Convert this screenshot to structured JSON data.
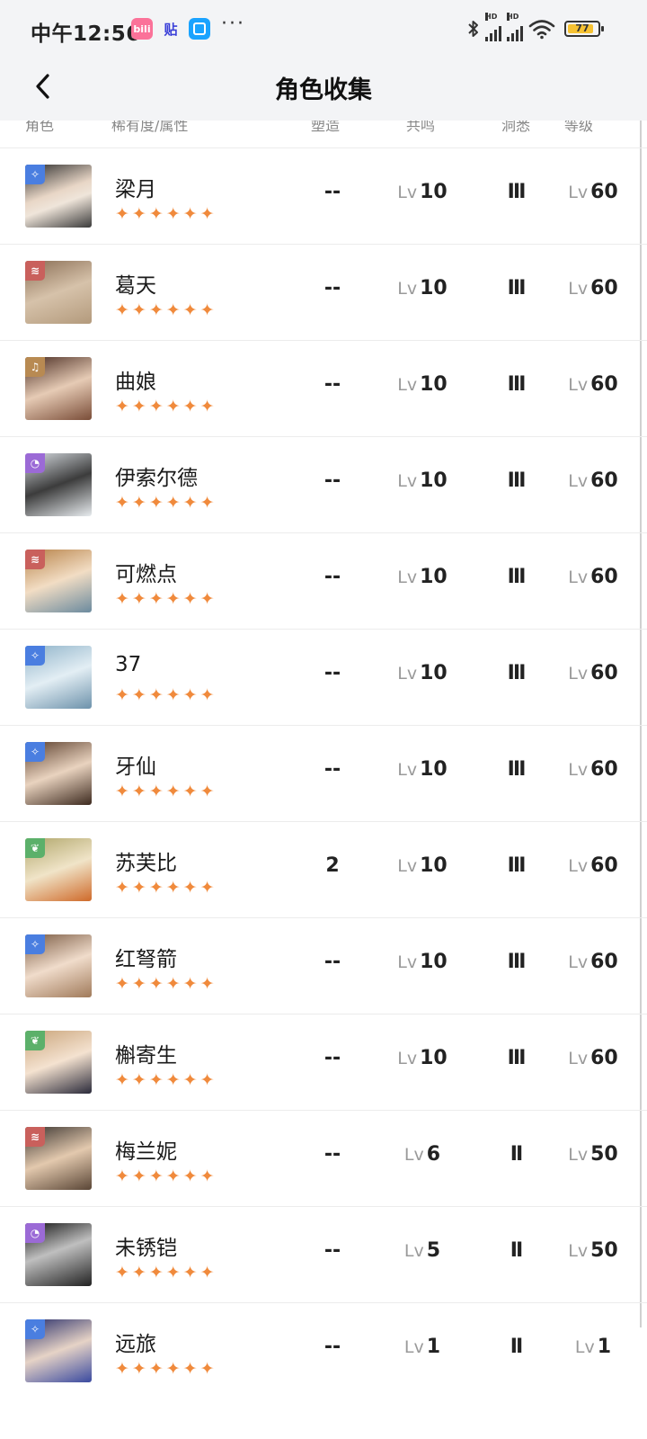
{
  "status_bar": {
    "time": "中午12:56",
    "apps": [
      "bili",
      "贴",
      ""
    ],
    "more": "···",
    "signal1_tag": "HD",
    "signal2_tag": "HD",
    "battery": "77"
  },
  "nav": {
    "back_icon": "chevron-left-icon",
    "title": "角色收集"
  },
  "columns": [
    "角色",
    "稀有度/属性",
    "塑造",
    "共鸣",
    "洞悉",
    "等级"
  ],
  "colors": {
    "star": "#f08a3c",
    "badge_blue": "#4a7ee0",
    "badge_red": "#c9605c",
    "badge_brown": "#b88a52",
    "badge_purple": "#9b6ad6",
    "badge_green": "#5cb06a"
  },
  "lv_prefix": "Lv",
  "rows": [
    {
      "name": "梁月",
      "stars": "✦✦✦✦✦✦",
      "element": "blue",
      "awaken": "--",
      "resonance": "10",
      "insight": "Ⅲ",
      "level": "60"
    },
    {
      "name": "葛天",
      "stars": "✦✦✦✦✦✦",
      "element": "red",
      "awaken": "--",
      "resonance": "10",
      "insight": "Ⅲ",
      "level": "60"
    },
    {
      "name": "曲娘",
      "stars": "✦✦✦✦✦✦",
      "element": "brown",
      "awaken": "--",
      "resonance": "10",
      "insight": "Ⅲ",
      "level": "60"
    },
    {
      "name": "伊索尔德",
      "stars": "✦✦✦✦✦✦",
      "element": "purple",
      "awaken": "--",
      "resonance": "10",
      "insight": "Ⅲ",
      "level": "60"
    },
    {
      "name": "可燃点",
      "stars": "✦✦✦✦✦✦",
      "element": "red",
      "awaken": "--",
      "resonance": "10",
      "insight": "Ⅲ",
      "level": "60"
    },
    {
      "name": "37",
      "stars": "✦✦✦✦✦✦",
      "element": "blue",
      "awaken": "--",
      "resonance": "10",
      "insight": "Ⅲ",
      "level": "60"
    },
    {
      "name": "牙仙",
      "stars": "✦✦✦✦✦✦",
      "element": "blue",
      "awaken": "--",
      "resonance": "10",
      "insight": "Ⅲ",
      "level": "60"
    },
    {
      "name": "苏芙比",
      "stars": "✦✦✦✦✦✦",
      "element": "green",
      "awaken": "2",
      "resonance": "10",
      "insight": "Ⅲ",
      "level": "60"
    },
    {
      "name": "红弩箭",
      "stars": "✦✦✦✦✦✦",
      "element": "blue",
      "awaken": "--",
      "resonance": "10",
      "insight": "Ⅲ",
      "level": "60"
    },
    {
      "name": "槲寄生",
      "stars": "✦✦✦✦✦✦",
      "element": "green",
      "awaken": "--",
      "resonance": "10",
      "insight": "Ⅲ",
      "level": "60"
    },
    {
      "name": "梅兰妮",
      "stars": "✦✦✦✦✦✦",
      "element": "red",
      "awaken": "--",
      "resonance": "6",
      "insight": "Ⅱ",
      "level": "50"
    },
    {
      "name": "未锈铠",
      "stars": "✦✦✦✦✦✦",
      "element": "purple",
      "awaken": "--",
      "resonance": "5",
      "insight": "Ⅱ",
      "level": "50"
    },
    {
      "name": "远旅",
      "stars": "✦✦✦✦✦✦",
      "element": "blue",
      "awaken": "--",
      "resonance": "1",
      "insight": "Ⅱ",
      "level": "1"
    }
  ]
}
